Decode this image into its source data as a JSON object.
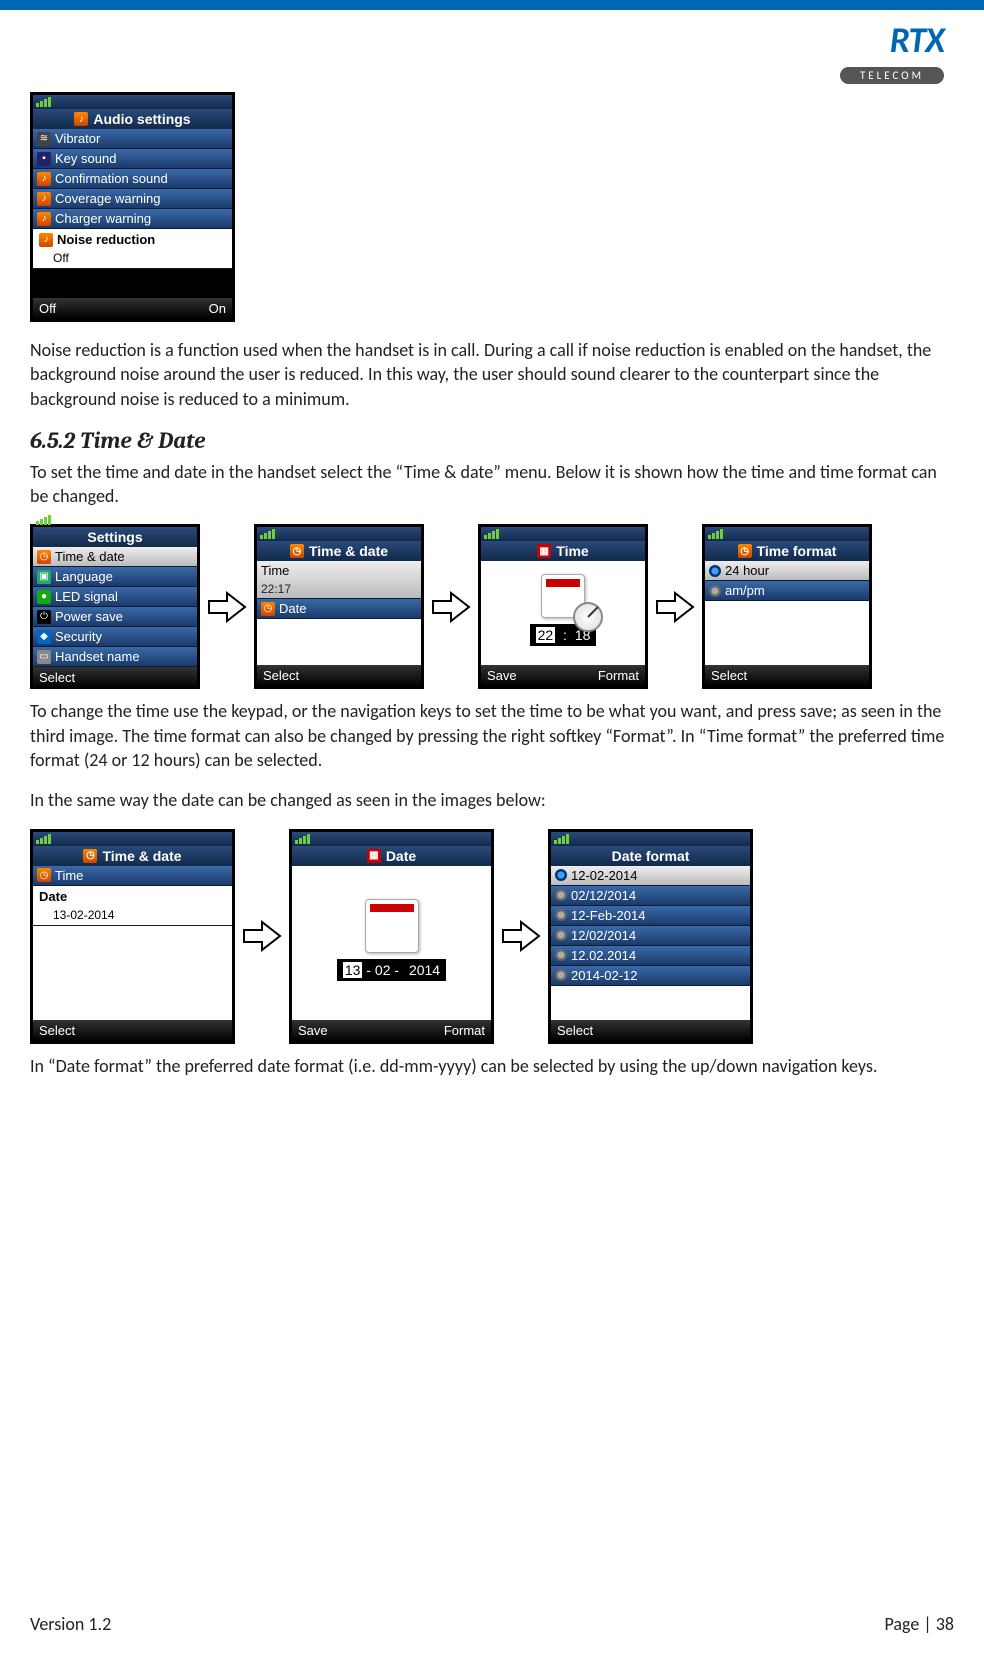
{
  "header": {
    "logo_text": "RTX",
    "logo_sub": "TELECOM"
  },
  "audio_screen": {
    "title": "Audio settings",
    "items": [
      "Vibrator",
      "Key sound",
      "Confirmation sound",
      "Coverage warning",
      "Charger warning"
    ],
    "selected_label": "Noise reduction",
    "selected_value": "Off",
    "soft_left": "Off",
    "soft_right": "On"
  },
  "para1": "Noise reduction is a function used when the handset is in call. During a call if noise reduction is enabled on the handset, the background noise around the user is reduced. In this way, the user should sound clearer to the counterpart since the background noise is reduced to a minimum.",
  "section_heading": "6.5.2 Time & Date",
  "para2": "To set the time and date in the handset select the “Time & date” menu. Below it is shown how the time and time format can be changed.",
  "time_row": {
    "s1": {
      "title": "Settings",
      "sel": "Time & date",
      "items": [
        "Language",
        "LED signal",
        "Power save",
        "Security",
        "Handset name"
      ],
      "soft_left": "Select"
    },
    "s2": {
      "title": "Time & date",
      "sel_label": "Time",
      "sel_value": "22:17",
      "item2": "Date",
      "soft_left": "Select"
    },
    "s3": {
      "title": "Time",
      "hours": "22",
      "sep": ":",
      "mins": "18",
      "soft_left": "Save",
      "soft_right": "Format"
    },
    "s4": {
      "title": "Time format",
      "opt1": "24 hour",
      "opt2": "am/pm",
      "soft_left": "Select"
    }
  },
  "para3": "To change the time use the keypad, or the navigation keys to set the time to be what you want, and press save; as seen in the third image. The time format can also be changed by pressing the right softkey “Format”.  In “Time format” the preferred time format (24 or 12 hours) can be selected.",
  "para4": "In the same way the date can be changed as seen in the images below:",
  "date_row": {
    "s1": {
      "title": "Time & date",
      "item1": "Time",
      "sel_label": "Date",
      "sel_value": "13-02-2014",
      "soft_left": "Select"
    },
    "s2": {
      "title": "Date",
      "day": "13",
      "month": "02",
      "year": "2014",
      "soft_left": "Save",
      "soft_right": "Format"
    },
    "s3": {
      "title": "Date format",
      "options": [
        "12-02-2014",
        "02/12/2014",
        "12-Feb-2014",
        "12/02/2014",
        "12.02.2014",
        "2014-02-12"
      ],
      "soft_left": "Select"
    }
  },
  "para5": "In “Date format” the preferred date format (i.e. dd-mm-yyyy) can be selected by using the up/down navigation keys.",
  "footer": {
    "version": "Version 1.2",
    "page": "Page | 38"
  }
}
